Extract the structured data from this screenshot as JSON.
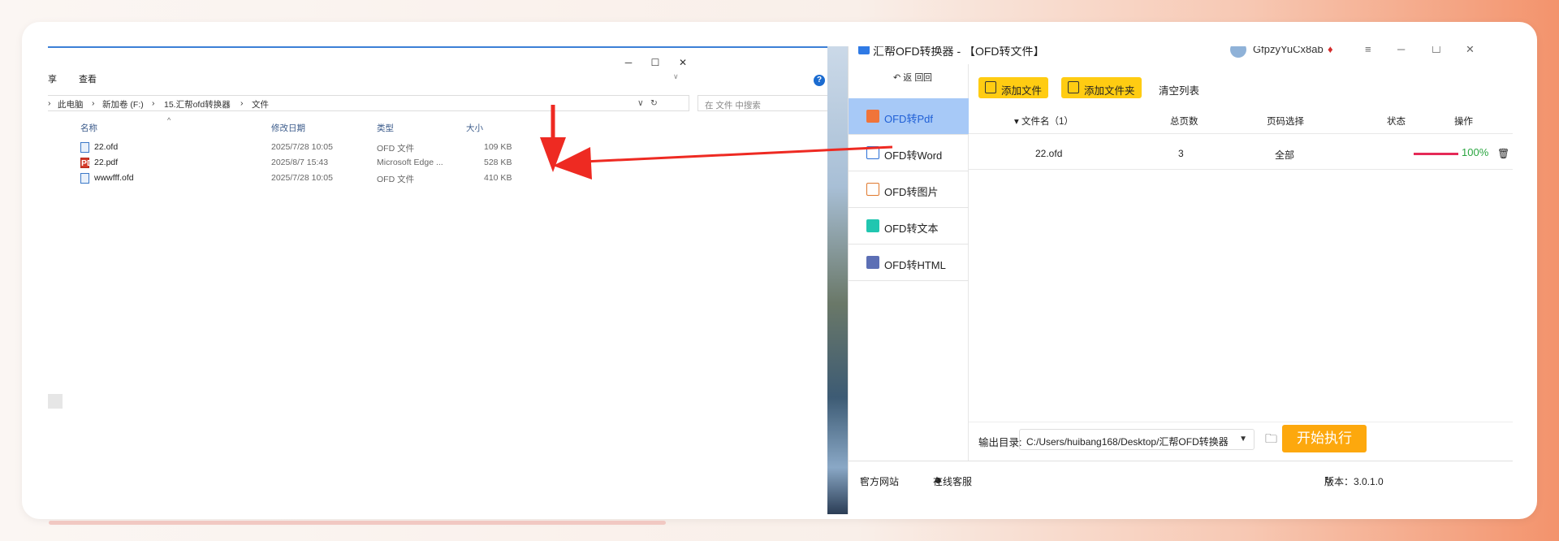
{
  "explorer": {
    "window_controls": {
      "minimize": "─",
      "maximize": "☐",
      "close": "✕"
    },
    "ribbon": {
      "share": "享",
      "view": "查看"
    },
    "address": [
      "›",
      "此电脑",
      "›",
      "新加卷 (F:)",
      "›",
      "15.汇帮ofd转换器",
      "›",
      "文件"
    ],
    "search_placeholder": "在 文件 中搜索",
    "columns": {
      "name": "名称",
      "modified": "修改日期",
      "type": "类型",
      "size": "大小"
    },
    "files": [
      {
        "name": "22.ofd",
        "modified": "2025/7/28 10:05",
        "type": "OFD 文件",
        "size": "109 KB",
        "icon": "ofd-file-icon"
      },
      {
        "name": "22.pdf",
        "modified": "2025/8/7 15:43",
        "type": "Microsoft Edge ...",
        "size": "528 KB",
        "icon": "pdf-file-icon"
      },
      {
        "name": "wwwfff.ofd",
        "modified": "2025/7/28 10:05",
        "type": "OFD 文件",
        "size": "410 KB",
        "icon": "ofd-file-icon"
      }
    ]
  },
  "app": {
    "title": "汇帮OFD转换器 - 【OFD转文件】",
    "user": "GfpzyYuCx8ab",
    "nav": {
      "back": "返 回",
      "home": "回"
    },
    "sidebar": [
      {
        "label": "OFD转Pdf",
        "icon": "pdf-icon",
        "color": "#f0743a"
      },
      {
        "label": "OFD转Word",
        "icon": "word-icon",
        "color": "#2b6fd6"
      },
      {
        "label": "OFD转图片",
        "icon": "image-icon",
        "color": "#e0782d"
      },
      {
        "label": "OFD转文本",
        "icon": "text-icon",
        "color": "#21c6b0"
      },
      {
        "label": "OFD转HTML",
        "icon": "html-icon",
        "color": "#5c6fb5"
      }
    ],
    "toolbar": {
      "add_file": "添加文件",
      "add_folder": "添加文件夹",
      "clear_list": "清空列表"
    },
    "table": {
      "headers": {
        "filename": "▾ 文件名（1）",
        "pages": "总页数",
        "page_select": "页码选择",
        "status": "状态",
        "action": "操作"
      },
      "rows": [
        {
          "filename": "22.ofd",
          "pages": "3",
          "page_select": "全部",
          "progress": 1.0,
          "status": "100%"
        }
      ]
    },
    "output": {
      "label": "输出目录:",
      "path": "C:/Users/huibang168/Desktop/汇帮OFD转换器",
      "start": "开始执行"
    },
    "statusbar": {
      "website": "官方网站",
      "support": "在线客服",
      "version": "版本：3.0.1.0"
    }
  },
  "colors": {
    "accent": "#ffcc12",
    "start": "#fda80d",
    "arrow": "#ee2a22",
    "active_nav": "#a7c9f7"
  }
}
